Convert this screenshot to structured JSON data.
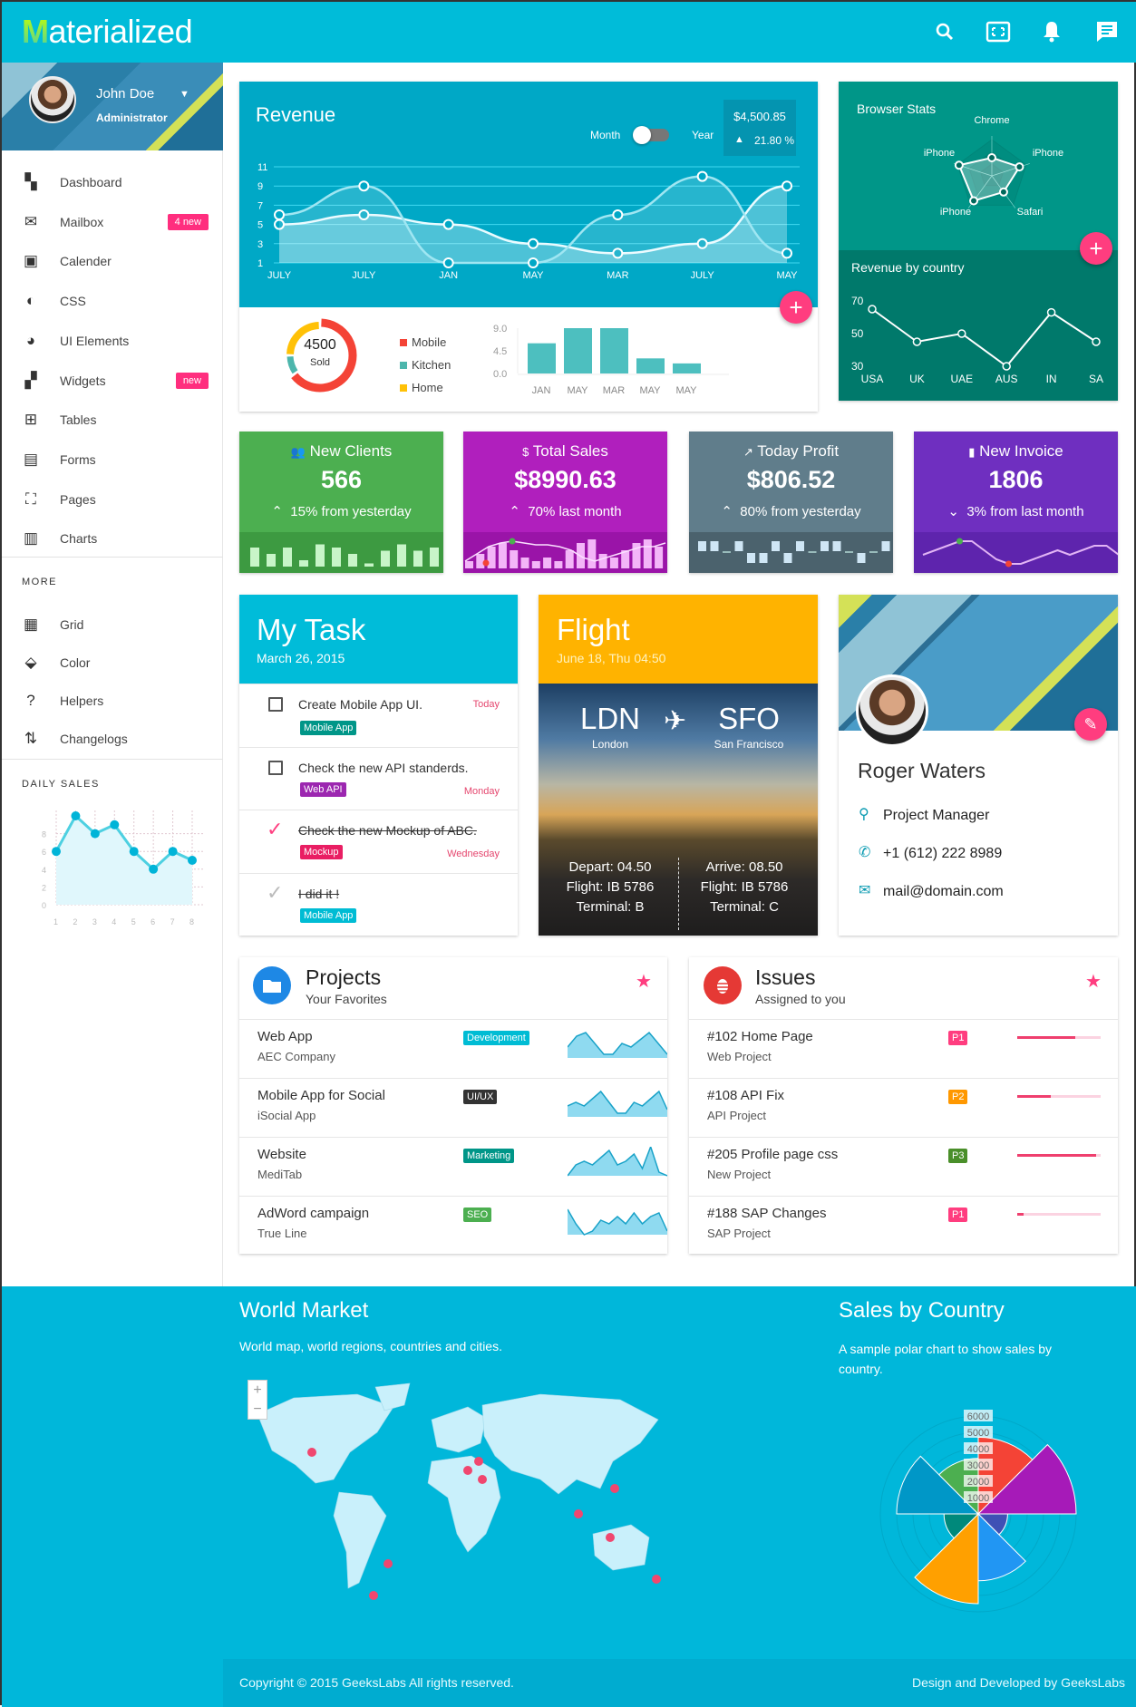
{
  "header": {
    "logo_letter": "M",
    "logo_rest": "aterialized",
    "icons": [
      "search-icon",
      "fullscreen-icon",
      "bell-icon",
      "chat-icon"
    ]
  },
  "user": {
    "name": "John Doe",
    "role": "Administrator"
  },
  "sidebar": {
    "items": [
      {
        "label": "Dashboard",
        "icon": "dashboard-icon",
        "glyph": "▚"
      },
      {
        "label": "Mailbox",
        "icon": "mail-icon",
        "glyph": "✉",
        "badge": "4 new"
      },
      {
        "label": "Calender",
        "icon": "calendar-icon",
        "glyph": "▣"
      },
      {
        "label": "CSS",
        "icon": "drop-icon",
        "glyph": "◐"
      },
      {
        "label": "UI Elements",
        "icon": "palette-icon",
        "glyph": "◕"
      },
      {
        "label": "Widgets",
        "icon": "widgets-icon",
        "glyph": "▞",
        "badge": "new"
      },
      {
        "label": "Tables",
        "icon": "table-icon",
        "glyph": "⊞"
      },
      {
        "label": "Forms",
        "icon": "forms-icon",
        "glyph": "▤"
      },
      {
        "label": "Pages",
        "icon": "pages-icon",
        "glyph": "⛶"
      },
      {
        "label": "Charts",
        "icon": "chart-icon",
        "glyph": "▥"
      }
    ],
    "more_title": "MORE",
    "more_items": [
      {
        "label": "Grid",
        "icon": "grid-icon",
        "glyph": "▦"
      },
      {
        "label": "Color",
        "icon": "paint-bucket-icon",
        "glyph": "⬙"
      },
      {
        "label": "Helpers",
        "icon": "help-icon",
        "glyph": "?"
      },
      {
        "label": "Changelogs",
        "icon": "changelog-icon",
        "glyph": "⇅"
      }
    ],
    "daily_sales_title": "DAILY SALES"
  },
  "revenue": {
    "title": "Revenue",
    "toggle_left": "Month",
    "toggle_right": "Year",
    "toggle_state": "month",
    "amount": "$4,500.85",
    "change": "21.80 %",
    "donut_value": "4500",
    "donut_label": "Sold"
  },
  "browser_stats": {
    "title": "Browser Stats"
  },
  "revenue_country": {
    "title": "Revenue by country"
  },
  "stats": [
    {
      "title": "New Clients",
      "icon": "users-icon",
      "glyph": "👥",
      "value": "566",
      "change": "15% from yesterday",
      "dir": "up",
      "color": "#4caf50",
      "dark": "#3d9a41"
    },
    {
      "title": "Total Sales",
      "icon": "dollar-icon",
      "glyph": "$",
      "value": "$8990.63",
      "change": "70% last month",
      "dir": "up",
      "color": "#b01fbd",
      "dark": "#9a14a8"
    },
    {
      "title": "Today Profit",
      "icon": "trending-up-icon",
      "glyph": "↗",
      "value": "$806.52",
      "change": "80% from yesterday",
      "dir": "up",
      "color": "#607d8b",
      "dark": "#4b626d"
    },
    {
      "title": "New Invoice",
      "icon": "document-icon",
      "glyph": "▮",
      "value": "1806",
      "change": "3% from last month",
      "dir": "down",
      "color": "#6f2fc0",
      "dark": "#5e24ad"
    }
  ],
  "task": {
    "title": "My Task",
    "date": "March 26, 2015",
    "items": [
      {
        "text": "Create Mobile App UI.",
        "tag": "Mobile App",
        "tag_color": "#009688",
        "due": "Today",
        "done": false
      },
      {
        "text": "Check the new API standerds.",
        "tag": "Web API",
        "tag_color": "#9c27b0",
        "due": "Monday",
        "done": false
      },
      {
        "text": "Check the new Mockup of ABC.",
        "tag": "Mockup",
        "tag_color": "#e91e63",
        "due": "Wednesday",
        "done": true,
        "check_color": "#ff4081"
      },
      {
        "text": "I did it !",
        "tag": "Mobile App",
        "tag_color": "#00bcd4",
        "due": "",
        "done": true,
        "check_color": "#bbb"
      }
    ]
  },
  "flight": {
    "title": "Flight",
    "date": "June 18, Thu 04:50",
    "from": "LDN",
    "from_city": "London",
    "to": "SFO",
    "to_city": "San Francisco",
    "depart": "Depart: 04.50",
    "depart_flight": "Flight: IB 5786",
    "depart_terminal": "Terminal: B",
    "arrive": "Arrive: 08.50",
    "arrive_flight": "Flight: IB 5786",
    "arrive_terminal": "Terminal: C"
  },
  "profile": {
    "name": "Roger Waters",
    "role": "Project Manager",
    "phone": "+1 (612) 222 8989",
    "email": "mail@domain.com"
  },
  "projects": {
    "title": "Projects",
    "subtitle": "Your Favorites",
    "rows": [
      {
        "title": "Web App",
        "sub": "AEC Company",
        "tag": "Development",
        "tag_color": "#00bcd4",
        "spark": [
          3,
          6,
          7,
          4,
          1,
          1,
          4,
          3,
          5,
          7,
          4,
          1
        ]
      },
      {
        "title": "Mobile App for Social",
        "sub": "iSocial App",
        "tag": "UI/UX",
        "tag_color": "#333333",
        "spark": [
          3,
          4,
          3,
          5,
          7,
          4,
          1,
          1,
          4,
          3,
          5,
          7,
          2
        ]
      },
      {
        "title": "Website",
        "sub": "MediTab",
        "tag": "Marketing",
        "tag_color": "#009688",
        "spark": [
          0,
          3,
          4,
          3,
          5,
          7,
          3,
          4,
          6,
          2,
          8,
          1,
          0
        ]
      },
      {
        "title": "AdWord campaign",
        "sub": "True Line",
        "tag": "SEO",
        "tag_color": "#4caf50",
        "spark": [
          7,
          3,
          0,
          1,
          4,
          3,
          5,
          3,
          6,
          3,
          5,
          6,
          1
        ]
      }
    ]
  },
  "issues": {
    "title": "Issues",
    "subtitle": "Assigned to you",
    "rows": [
      {
        "title": "#102 Home Page",
        "sub": "Web Project",
        "priority": "P1",
        "p_color": "#ff3d7f",
        "progress": 70
      },
      {
        "title": "#108 API Fix",
        "sub": "API Project",
        "priority": "P2",
        "p_color": "#ff9800",
        "progress": 40
      },
      {
        "title": "#205 Profile page css",
        "sub": "New Project",
        "priority": "P3",
        "p_color": "#4a8f2a",
        "progress": 95
      },
      {
        "title": "#188 SAP Changes",
        "sub": "SAP Project",
        "priority": "P1",
        "p_color": "#ff3d7f",
        "progress": 8
      }
    ]
  },
  "world": {
    "title": "World Market",
    "subtitle": "World map, world regions, countries and cities.",
    "zoom_in": "+",
    "zoom_out": "−"
  },
  "sales_country": {
    "title": "Sales by Country",
    "subtitle": "A sample polar chart to show sales by country."
  },
  "footer": {
    "left": "Copyright © 2015 GeeksLabs All rights reserved.",
    "right": "Design and Developed by GeeksLabs"
  },
  "colors": {
    "primary": "#00bcd9",
    "accent": "#ff3d7f",
    "teal": "#009688"
  },
  "chart_data": [
    {
      "id": "revenue",
      "type": "area",
      "categories": [
        "JULY",
        "JULY",
        "JAN",
        "MAY",
        "MAR",
        "JULY",
        "MAY"
      ],
      "series": [
        {
          "values": [
            5,
            6,
            5,
            3,
            2,
            3,
            9
          ]
        },
        {
          "values": [
            6,
            9,
            1,
            1,
            6,
            10,
            2
          ]
        }
      ],
      "yticks": [
        1,
        3,
        5,
        7,
        9,
        11
      ],
      "ylim": [
        1,
        11
      ],
      "grid": true
    },
    {
      "id": "sold-donut",
      "type": "pie",
      "categories": [
        "Mobile",
        "Kitchen",
        "Home"
      ],
      "values": [
        65,
        10,
        25
      ],
      "colors": [
        "#f44336",
        "#4db6ac",
        "#ffc107"
      ]
    },
    {
      "id": "monthly-bars",
      "type": "bar",
      "categories": [
        "JAN",
        "MAY",
        "MAR",
        "MAY",
        "MAY"
      ],
      "values": [
        6,
        9,
        9,
        3,
        2
      ],
      "yticks": [
        "9.0",
        "4.5",
        "0.0"
      ],
      "ylim": [
        0,
        9
      ]
    },
    {
      "id": "browser-radar",
      "type": "radar",
      "categories": [
        "Chrome",
        "iPhone",
        "Safari",
        "iPhone",
        "iPhone"
      ],
      "values": [
        0.5,
        0.8,
        0.55,
        0.85,
        0.95
      ]
    },
    {
      "id": "revenue-by-country",
      "type": "line",
      "categories": [
        "USA",
        "UK",
        "UAE",
        "AUS",
        "IN",
        "SA"
      ],
      "values": [
        65,
        45,
        50,
        30,
        63,
        45
      ],
      "yticks": [
        70,
        50,
        30
      ],
      "ylim": [
        30,
        70
      ]
    },
    {
      "id": "daily-sales",
      "type": "line",
      "categories": [
        "1",
        "2",
        "3",
        "4",
        "5",
        "6",
        "7",
        "8"
      ],
      "values": [
        6,
        10,
        8,
        9,
        6,
        4,
        6,
        5
      ],
      "yticks": [
        0,
        2,
        4,
        6,
        8
      ],
      "ylim": [
        0,
        10
      ],
      "grid": true
    },
    {
      "id": "new-clients-spark",
      "type": "bar",
      "values": [
        6,
        4,
        6,
        2,
        7,
        6,
        4,
        1,
        5,
        7,
        5,
        6
      ]
    },
    {
      "id": "total-sales-spark",
      "type": "bar",
      "values": [
        2,
        4,
        6,
        7,
        5,
        3,
        2,
        3,
        2,
        5,
        7,
        8,
        4,
        3,
        5,
        7,
        8,
        6
      ],
      "line": [
        2,
        4,
        6,
        7,
        7.5,
        7,
        6.5,
        6.5,
        6,
        5,
        3,
        2,
        3,
        4,
        5,
        6,
        6,
        7
      ]
    },
    {
      "id": "today-profit-spark",
      "type": "bar",
      "values": [
        1,
        1,
        0,
        1,
        -1,
        -1,
        1,
        -1,
        1,
        0,
        1,
        1,
        0,
        -1,
        0,
        1
      ]
    },
    {
      "id": "new-invoice-spark",
      "type": "line",
      "values": [
        3,
        4,
        5,
        6,
        6,
        4,
        2,
        1,
        1,
        2,
        3,
        4,
        3,
        4,
        5,
        5,
        3
      ]
    },
    {
      "id": "sales-polar",
      "type": "polar",
      "rticks": [
        1000,
        2000,
        3000,
        4000,
        5000,
        6000
      ],
      "values": [
        4700,
        6000,
        1800,
        4100,
        5500,
        2100,
        5000,
        3400
      ],
      "colors": [
        "#f44336",
        "#a61ab8",
        "#3f51b5",
        "#2196f3",
        "#ffa000",
        "#00897b",
        "#0097c7",
        "#4caf50"
      ]
    }
  ]
}
